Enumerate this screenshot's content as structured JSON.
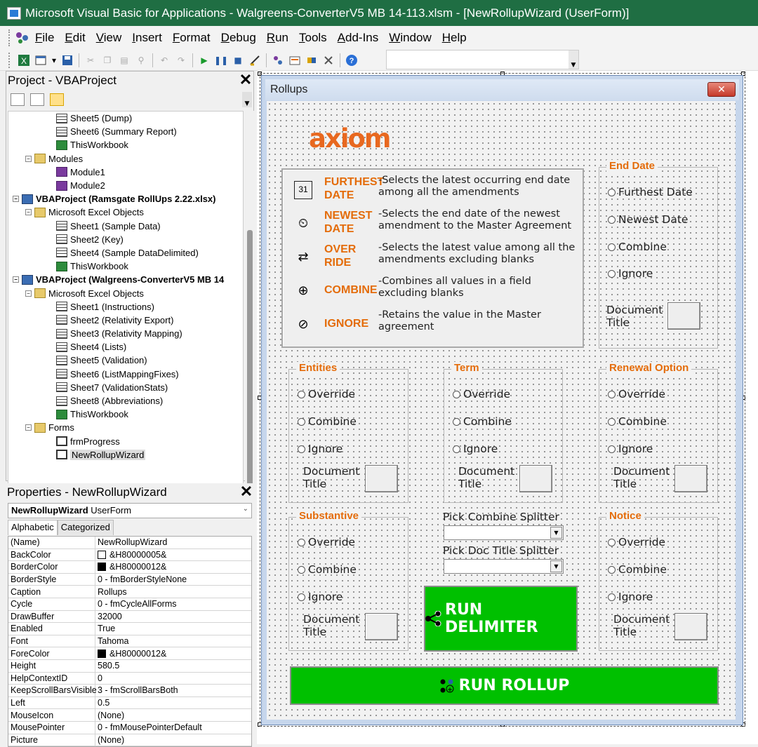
{
  "window": {
    "title": "Microsoft Visual Basic for Applications - Walgreens-ConverterV5 MB 14-113.xlsm - [NewRollupWizard (UserForm)]"
  },
  "menu": [
    "File",
    "Edit",
    "View",
    "Insert",
    "Format",
    "Debug",
    "Run",
    "Tools",
    "Add-Ins",
    "Window",
    "Help"
  ],
  "project": {
    "title": "Project - VBAProject",
    "close": "✕",
    "tree": [
      {
        "label": "Sheet5 (Dump)",
        "indent": 3,
        "icon": "sheet"
      },
      {
        "label": "Sheet6 (Summary Report)",
        "indent": 3,
        "icon": "sheet"
      },
      {
        "label": "ThisWorkbook",
        "indent": 3,
        "icon": "book"
      },
      {
        "label": "Modules",
        "indent": 2,
        "icon": "folder",
        "exp": "−"
      },
      {
        "label": "Module1",
        "indent": 3,
        "icon": "mod"
      },
      {
        "label": "Module2",
        "indent": 3,
        "icon": "mod"
      },
      {
        "label": "VBAProject (Ramsgate RollUps 2.22.xlsx)",
        "indent": 1,
        "icon": "proj",
        "exp": "−",
        "bold": true
      },
      {
        "label": "Microsoft Excel Objects",
        "indent": 2,
        "icon": "folder",
        "exp": "−"
      },
      {
        "label": "Sheet1 (Sample Data)",
        "indent": 3,
        "icon": "sheet"
      },
      {
        "label": "Sheet2 (Key)",
        "indent": 3,
        "icon": "sheet"
      },
      {
        "label": "Sheet4 (Sample DataDelimited)",
        "indent": 3,
        "icon": "sheet"
      },
      {
        "label": "ThisWorkbook",
        "indent": 3,
        "icon": "book"
      },
      {
        "label": "VBAProject (Walgreens-ConverterV5 MB 14",
        "indent": 1,
        "icon": "proj",
        "exp": "−",
        "bold": true
      },
      {
        "label": "Microsoft Excel Objects",
        "indent": 2,
        "icon": "folder",
        "exp": "−"
      },
      {
        "label": "Sheet1 (Instructions)",
        "indent": 3,
        "icon": "sheet"
      },
      {
        "label": "Sheet2 (Relativity Export)",
        "indent": 3,
        "icon": "sheet"
      },
      {
        "label": "Sheet3 (Relativity Mapping)",
        "indent": 3,
        "icon": "sheet"
      },
      {
        "label": "Sheet4 (Lists)",
        "indent": 3,
        "icon": "sheet"
      },
      {
        "label": "Sheet5 (Validation)",
        "indent": 3,
        "icon": "sheet"
      },
      {
        "label": "Sheet6 (ListMappingFixes)",
        "indent": 3,
        "icon": "sheet"
      },
      {
        "label": "Sheet7 (ValidationStats)",
        "indent": 3,
        "icon": "sheet"
      },
      {
        "label": "Sheet8 (Abbreviations)",
        "indent": 3,
        "icon": "sheet"
      },
      {
        "label": "ThisWorkbook",
        "indent": 3,
        "icon": "book"
      },
      {
        "label": "Forms",
        "indent": 2,
        "icon": "folder",
        "exp": "−"
      },
      {
        "label": "frmProgress",
        "indent": 3,
        "icon": "form"
      },
      {
        "label": "NewRollupWizard",
        "indent": 3,
        "icon": "form",
        "selected": true
      }
    ]
  },
  "properties": {
    "title": "Properties - NewRollupWizard",
    "close": "✕",
    "object_name": "NewRollupWizard",
    "object_type": "UserForm",
    "tabs": [
      "Alphabetic",
      "Categorized"
    ],
    "rows": [
      {
        "k": "(Name)",
        "v": "NewRollupWizard"
      },
      {
        "k": "BackColor",
        "v": "&H80000005&",
        "swatch": "#ffffff"
      },
      {
        "k": "BorderColor",
        "v": "&H80000012&",
        "swatch": "#000000"
      },
      {
        "k": "BorderStyle",
        "v": "0 - fmBorderStyleNone"
      },
      {
        "k": "Caption",
        "v": "Rollups"
      },
      {
        "k": "Cycle",
        "v": "0 - fmCycleAllForms"
      },
      {
        "k": "DrawBuffer",
        "v": "32000"
      },
      {
        "k": "Enabled",
        "v": "True"
      },
      {
        "k": "Font",
        "v": "Tahoma"
      },
      {
        "k": "ForeColor",
        "v": "&H80000012&",
        "swatch": "#000000"
      },
      {
        "k": "Height",
        "v": "580.5"
      },
      {
        "k": "HelpContextID",
        "v": "0"
      },
      {
        "k": "KeepScrollBarsVisible",
        "v": "3 - fmScrollBarsBoth"
      },
      {
        "k": "Left",
        "v": "0.5"
      },
      {
        "k": "MouseIcon",
        "v": "(None)"
      },
      {
        "k": "MousePointer",
        "v": "0 - fmMousePointerDefault"
      },
      {
        "k": "Picture",
        "v": "(None)"
      }
    ]
  },
  "form": {
    "caption": "Rollups",
    "close": "✕",
    "logo": "axiom",
    "legend": [
      {
        "icon": "calendar-icon",
        "glyph": "31",
        "name": "FURTHEST DATE",
        "desc": "-Selects the latest occurring end date among all the amendments"
      },
      {
        "icon": "date-clock-icon",
        "glyph": "⏲",
        "name": "NEWEST DATE",
        "desc": "-Selects the end date of the newest amendment to the Master Agreement"
      },
      {
        "icon": "override-icon",
        "glyph": "⇄",
        "name": "OVER RIDE",
        "desc": "-Selects the latest value among all the amendments excluding blanks"
      },
      {
        "icon": "combine-icon",
        "glyph": "⊕",
        "name": "COMBINE",
        "desc": "-Combines all values in a field excluding blanks"
      },
      {
        "icon": "ignore-icon",
        "glyph": "⊘",
        "name": "IGNORE",
        "desc": "-Retains the value in the Master agreement"
      }
    ],
    "end_date": {
      "title": "End Date",
      "options": [
        "Furthest Date",
        "Newest Date",
        "Combine",
        "Ignore"
      ],
      "doc_title": "Document Title"
    },
    "entities": {
      "title": "Entities",
      "options": [
        "Override",
        "Combine",
        "Ignore"
      ],
      "doc_title": "Document Title"
    },
    "term": {
      "title": "Term",
      "options": [
        "Override",
        "Combine",
        "Ignore"
      ],
      "doc_title": "Document Title"
    },
    "renewal": {
      "title": "Renewal Option",
      "options": [
        "Override",
        "Combine",
        "Ignore"
      ],
      "doc_title": "Document Title"
    },
    "substantive": {
      "title": "Substantive",
      "options": [
        "Override",
        "Combine",
        "Ignore"
      ],
      "doc_title": "Document Title"
    },
    "notice": {
      "title": "Notice",
      "options": [
        "Override",
        "Combine",
        "Ignore"
      ],
      "doc_title": "Document Title"
    },
    "combine_splitter_label": "Pick Combine Splitter",
    "doc_title_splitter_label": "Pick Doc Title Splitter",
    "run_delimiter": "RUN DELIMITER",
    "run_rollup": "RUN ROLLUP",
    "accent": "#e46c0a",
    "button_green": "#00c000"
  }
}
